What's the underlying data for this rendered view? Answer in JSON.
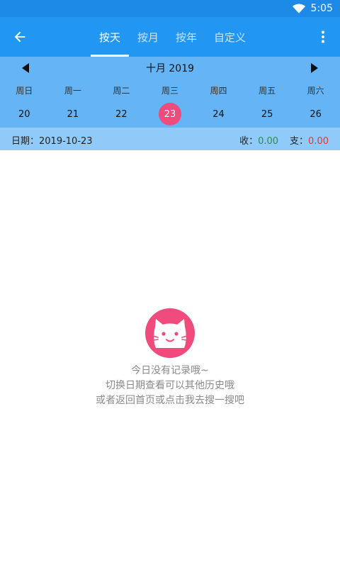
{
  "status": {
    "time": "5:05"
  },
  "header": {
    "tabs": [
      {
        "label": "按天",
        "active": true
      },
      {
        "label": "按月",
        "active": false
      },
      {
        "label": "按年",
        "active": false
      },
      {
        "label": "自定义",
        "active": false
      }
    ]
  },
  "calendar": {
    "month_title": "十月 2019",
    "weekdays": [
      "周日",
      "周一",
      "周二",
      "周三",
      "周四",
      "周五",
      "周六"
    ],
    "days": [
      "20",
      "21",
      "22",
      "23",
      "24",
      "25",
      "26"
    ],
    "selected_day": "23"
  },
  "summary": {
    "date_label": "日期：",
    "date_value": "2019-10-23",
    "income_label": "收：",
    "income_value": "0.00",
    "expense_label": "支：",
    "expense_value": "0.00"
  },
  "empty_state": {
    "line1": "今日没有记录哦~",
    "line2": "切换日期查看可以其他历史哦",
    "line3": "或者返回首页或点击我去搜一搜吧"
  },
  "colors": {
    "status_bar": "#1e8ae8",
    "app_bar": "#2196f3",
    "calendar_bg": "#64b4f6",
    "summary_bg": "#90caf9",
    "accent_pink": "#ef4b7c",
    "income": "#2e8b57",
    "expense": "#e53935"
  }
}
